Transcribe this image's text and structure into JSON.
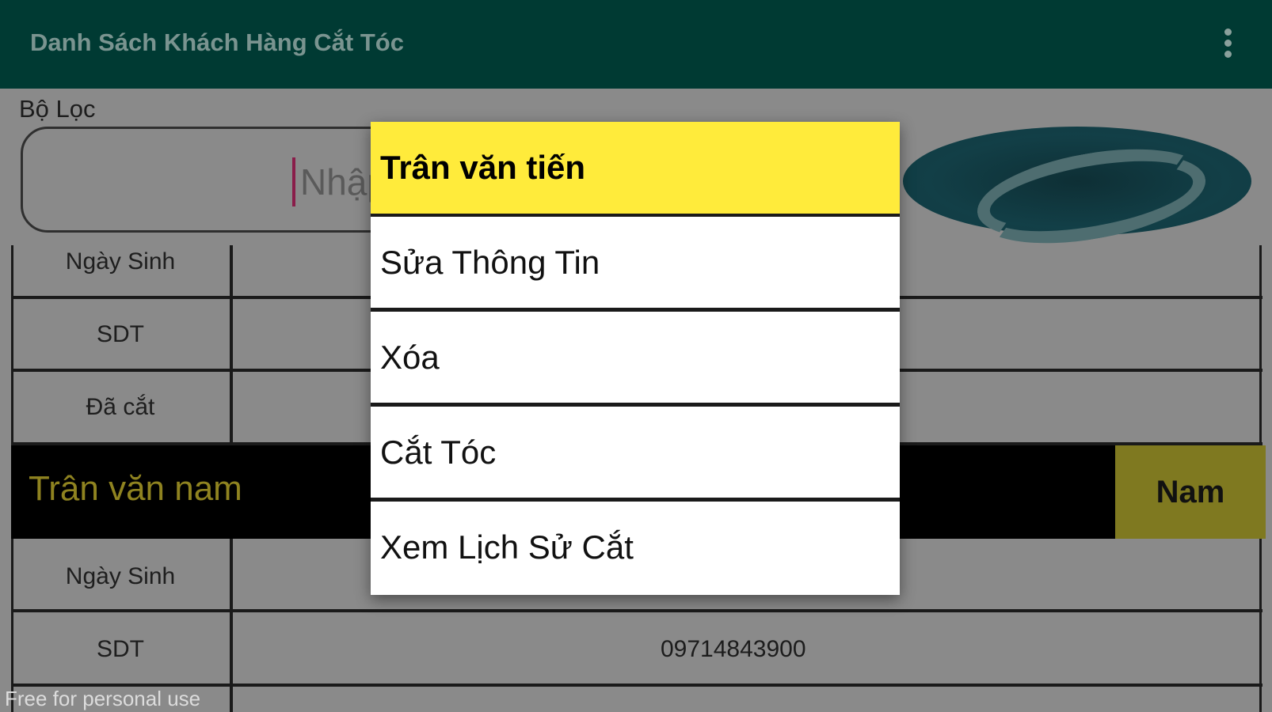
{
  "app_bar": {
    "title": "Danh Sách Khách Hàng Cắt Tóc",
    "menu_icon": "more-vert-icon"
  },
  "filter": {
    "label": "Bộ Lọc",
    "placeholder": "Nhập"
  },
  "refresh_icon": "refresh-icon",
  "records": [
    {
      "rows": [
        {
          "label": "Ngày Sinh",
          "value": ""
        },
        {
          "label": "SDT",
          "value": ""
        },
        {
          "label": "Đã cắt",
          "value": ""
        }
      ]
    },
    {
      "name": "Trân văn nam",
      "gender": "Nam",
      "rows": [
        {
          "label": "Ngày Sinh",
          "value": ""
        },
        {
          "label": "SDT",
          "value": "09714843900"
        }
      ]
    }
  ],
  "context_menu": {
    "title": "Trân văn tiến",
    "items": [
      "Sửa Thông Tin",
      "Xóa",
      "Cắt Tóc",
      "Xem Lịch Sử Cắt"
    ]
  },
  "watermark": "Free for personal use",
  "colors": {
    "app_bar": "#004d40",
    "dialog_title": "#ffeb3b",
    "name_text": "#d4c63a",
    "gender_bg": "#c8c03a"
  }
}
